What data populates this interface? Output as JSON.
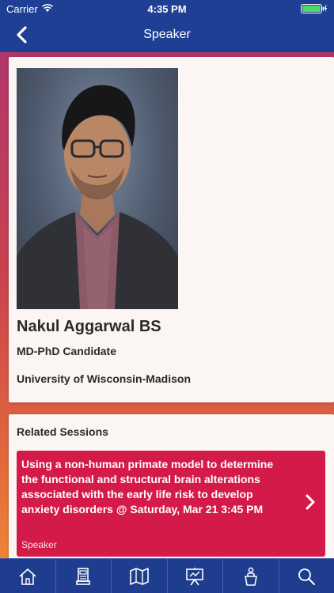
{
  "status_bar": {
    "carrier": "Carrier",
    "time": "4:35 PM",
    "wifi_icon": "wifi-icon",
    "battery_icon": "battery-icon",
    "battery_color": "#4cd964"
  },
  "nav": {
    "title": "Speaker",
    "back_icon": "chevron-left-icon"
  },
  "speaker": {
    "name": "Nakul Aggarwal BS",
    "role": "MD-PhD Candidate",
    "organization": "University of Wisconsin-Madison"
  },
  "related_sessions": {
    "heading": "Related Sessions",
    "items": [
      {
        "title": "Using a non-human primate model to determine the functional and structural brain alterations associated with the early life risk to develop anxiety disorders @ Saturday, Mar 21 3:45 PM",
        "role": "Speaker",
        "color": "#d31a48"
      }
    ]
  },
  "tab_bar": {
    "items": [
      {
        "icon": "home-icon"
      },
      {
        "icon": "kiosk-icon"
      },
      {
        "icon": "map-icon"
      },
      {
        "icon": "presentation-icon"
      },
      {
        "icon": "speaker-podium-icon"
      },
      {
        "icon": "search-icon"
      }
    ]
  },
  "colors": {
    "nav_background": "#1f3f95",
    "card_background": "#fbf5f3",
    "accent": "#d31a48"
  }
}
